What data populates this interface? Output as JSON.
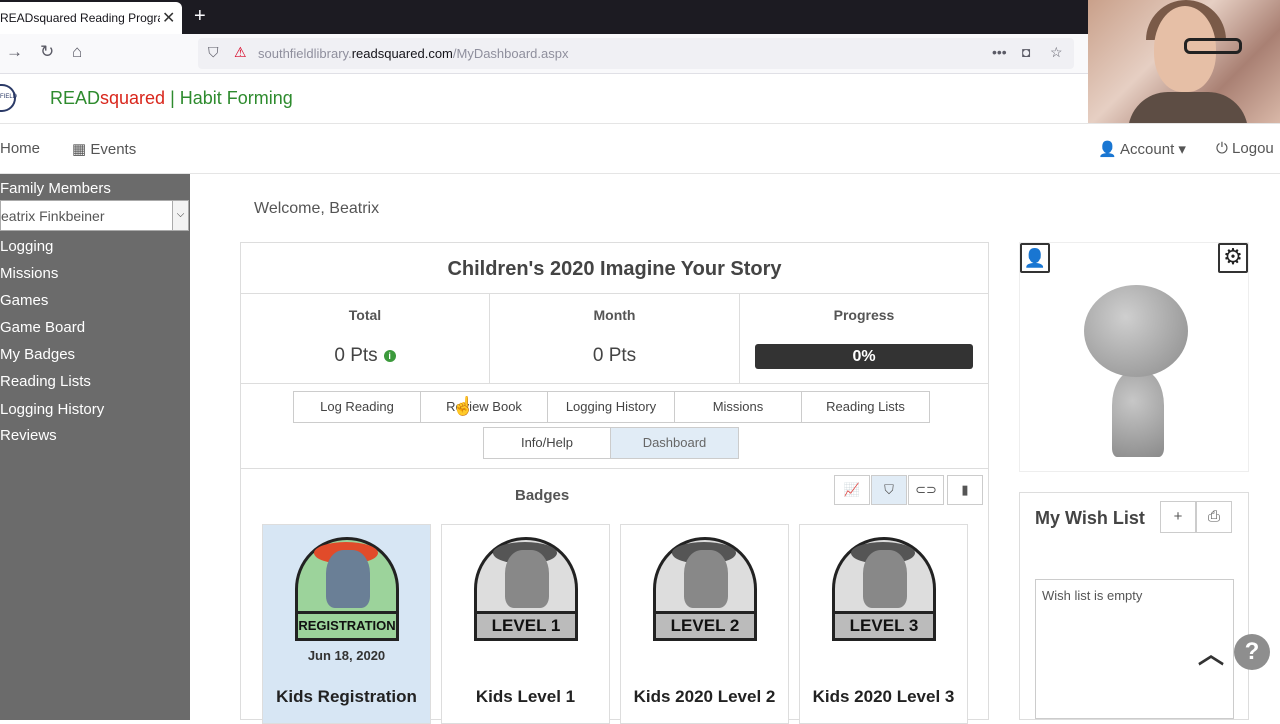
{
  "browser": {
    "tab_title": "READsquared Reading Program",
    "close_glyph": "✕",
    "new_tab_glyph": "+",
    "url_host_prefix": "southfieldlibrary.",
    "url_host_main": "readsquared.com",
    "url_path": "/MyDashboard.aspx",
    "icons": [
      "forward-icon",
      "reload-icon",
      "home-icon",
      "shield-icon",
      "insecure-icon",
      "more-icon",
      "pocket-icon",
      "bookmark-icon"
    ]
  },
  "site": {
    "logo_text": "FIELD",
    "brand_read": "READ",
    "brand_squared": "squared",
    "brand_sep": " | ",
    "brand_tagline": "Habit Forming",
    "nav": {
      "home": "Home",
      "events": "Events",
      "account": "Account",
      "logout": "Logou"
    }
  },
  "sidebar": {
    "family_label": "Family Members",
    "selected_member": "eatrix Finkbeiner",
    "items": [
      "Logging",
      "Missions",
      "Games",
      "Game Board",
      "My Badges",
      "Reading Lists",
      "Logging History",
      "Reviews"
    ]
  },
  "main": {
    "welcome": "Welcome,  Beatrix",
    "program_title": "Children's 2020 Imagine Your Story",
    "stats": {
      "total_label": "Total",
      "total_value": "0 Pts",
      "month_label": "Month",
      "month_value": "0 Pts",
      "progress_label": "Progress",
      "progress_value": "0%",
      "progress_fraction": 0.0
    },
    "action_buttons": [
      "Log Reading",
      "Review Book",
      "Logging History",
      "Missions",
      "Reading Lists"
    ],
    "view_buttons": [
      "Info/Help",
      "Dashboard"
    ],
    "active_view": "Dashboard",
    "badges_label": "Badges",
    "badges": [
      {
        "ribbon": "REGISTRATION",
        "date": "Jun 18, 2020",
        "name": "Kids Registration",
        "earned": true
      },
      {
        "ribbon": "LEVEL 1",
        "date": "",
        "name": "Kids Level 1",
        "earned": false
      },
      {
        "ribbon": "LEVEL 2",
        "date": "",
        "name": "Kids 2020 Level 2",
        "earned": false
      },
      {
        "ribbon": "LEVEL 3",
        "date": "",
        "name": "Kids 2020 Level 3",
        "earned": false
      }
    ]
  },
  "wishlist": {
    "title": "My Wish List",
    "empty_text": "Wish list is empty"
  },
  "colors": {
    "brand_green": "#2e8b2e",
    "brand_red": "#d9261c",
    "sidebar_bg": "#6b6b6b",
    "active_tab_bg": "#e1ecf6"
  }
}
